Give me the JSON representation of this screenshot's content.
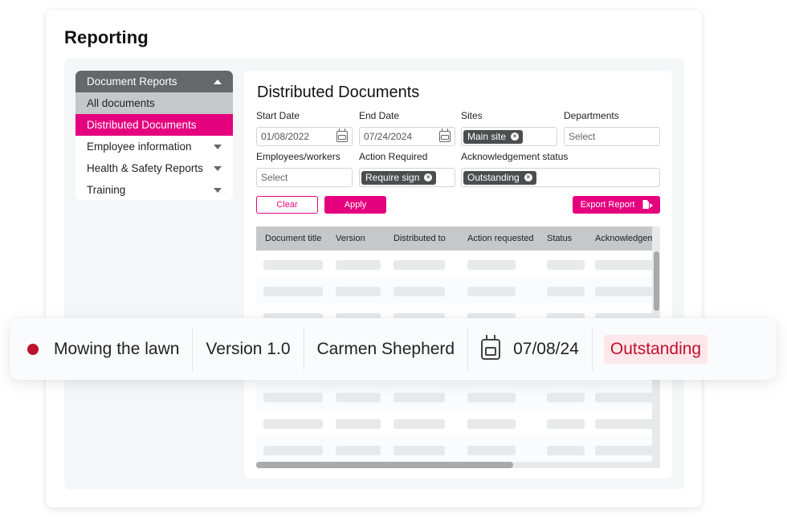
{
  "page": {
    "title": "Reporting"
  },
  "sidebar": {
    "header": "Document Reports",
    "items": [
      {
        "label": "All documents",
        "state": "selected-group"
      },
      {
        "label": "Distributed Documents",
        "state": "active"
      },
      {
        "label": "Employee information",
        "expandable": true
      },
      {
        "label": "Health & Safety Reports",
        "expandable": true
      },
      {
        "label": "Training",
        "expandable": true
      }
    ]
  },
  "content": {
    "title": "Distributed Documents",
    "filters": {
      "start_date": {
        "label": "Start Date",
        "value": "01/08/2022",
        "icon": "calendar-icon"
      },
      "end_date": {
        "label": "End Date",
        "value": "07/24/2024",
        "icon": "calendar-icon"
      },
      "sites": {
        "label": "Sites",
        "chips": [
          "Main site"
        ]
      },
      "departments": {
        "label": "Departments",
        "placeholder": "Select"
      },
      "employees": {
        "label": "Employees/workers",
        "placeholder": "Select"
      },
      "action_required": {
        "label": "Action Required",
        "chips": [
          "Require sign"
        ]
      },
      "ack_status": {
        "label": "Acknowledgement status",
        "chips": [
          "Outstanding"
        ]
      }
    },
    "buttons": {
      "clear": "Clear",
      "apply": "Apply",
      "export": "Export Report"
    },
    "table": {
      "columns": [
        "Document title",
        "Version",
        "Distributed to",
        "Action requested",
        "Status",
        "Acknowledgem"
      ],
      "loading_rows": 8,
      "vertical_scroll_position": 0.1,
      "horizontal_scroll_visible_fraction": 0.64
    }
  },
  "highlight_row": {
    "status_dot_color": "#c0102e",
    "document_title": "Mowing the lawn",
    "version": "Version 1.0",
    "distributed_to": "Carmen Shepherd",
    "date": "07/08/24",
    "status": "Outstanding"
  },
  "colors": {
    "accent": "#e5007e",
    "sidebar_header": "#666769",
    "table_header": "#c6c7c9",
    "status_outstanding_text": "#c0102e",
    "status_outstanding_bg": "#fde7ea"
  }
}
